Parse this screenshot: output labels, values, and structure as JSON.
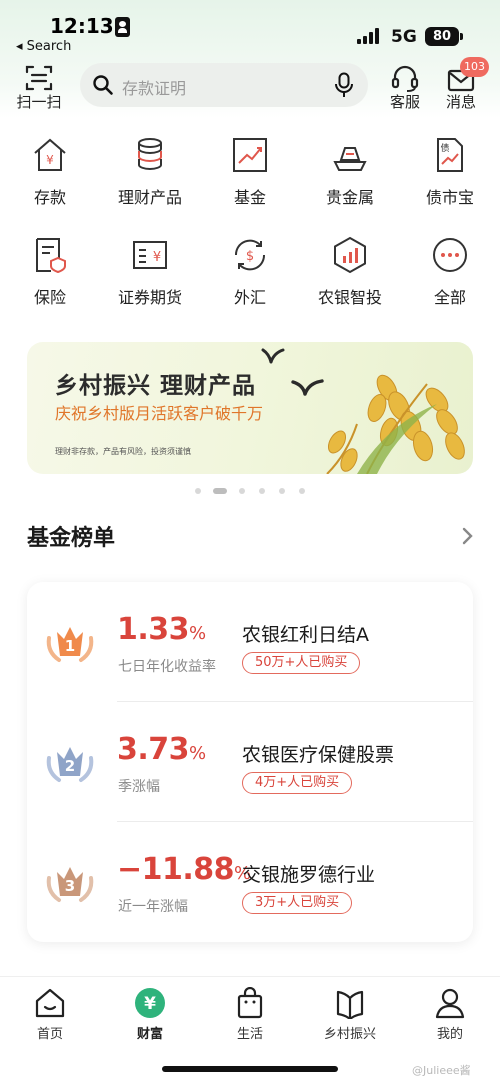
{
  "status_bar": {
    "time": "12:13",
    "back_app": "◂ Search",
    "network": "5G",
    "battery": "80"
  },
  "top_bar": {
    "scan_label": "扫一扫",
    "search_placeholder": "存款证明",
    "service_label": "客服",
    "messages_label": "消息",
    "messages_badge": "103"
  },
  "grid": [
    {
      "label": "存款",
      "icon": "deposit-house-icon"
    },
    {
      "label": "理财产品",
      "icon": "coins-stack-icon"
    },
    {
      "label": "基金",
      "icon": "chart-trend-icon"
    },
    {
      "label": "贵金属",
      "icon": "gold-bar-icon"
    },
    {
      "label": "债市宝",
      "icon": "bond-doc-icon"
    },
    {
      "label": "保险",
      "icon": "insurance-doc-icon"
    },
    {
      "label": "证券期货",
      "icon": "securities-icon"
    },
    {
      "label": "外汇",
      "icon": "forex-icon"
    },
    {
      "label": "农银智投",
      "icon": "smart-invest-icon"
    },
    {
      "label": "全部",
      "icon": "more-dots-icon"
    }
  ],
  "banner": {
    "title": "乡村振兴 理财产品",
    "subtitle": "庆祝乡村版月活跃客户破千万",
    "note": "理财非存款，产品有风险，投资须谨慎"
  },
  "carousel": {
    "count": 6,
    "active_index": 1
  },
  "fund_list": {
    "title": "基金榜单",
    "items": [
      {
        "rank": "1",
        "value": "1.33",
        "pct": "%",
        "metric": "七日年化收益率",
        "name": "农银红利日结A",
        "buyers": "50万+人已购买"
      },
      {
        "rank": "2",
        "value": "3.73",
        "pct": "%",
        "metric": "季涨幅",
        "name": "农银医疗保健股票",
        "buyers": "4万+人已购买"
      },
      {
        "rank": "3",
        "value": "−11.88",
        "pct": "%",
        "metric": "近一年涨幅",
        "name": "交银施罗德行业",
        "buyers": "3万+人已购买"
      }
    ]
  },
  "tabs": [
    {
      "label": "首页",
      "icon": "home-icon"
    },
    {
      "label": "财富",
      "icon": "wealth-icon"
    },
    {
      "label": "生活",
      "icon": "shopping-bag-icon"
    },
    {
      "label": "乡村振兴",
      "icon": "rural-book-icon"
    },
    {
      "label": "我的",
      "icon": "profile-icon"
    }
  ],
  "active_tab": "财富",
  "watermark": "@Julieee酱",
  "colors": {
    "accent_red": "#d9443b",
    "brand_green": "#2fb37c",
    "badge_red": "#ef6a5f"
  }
}
